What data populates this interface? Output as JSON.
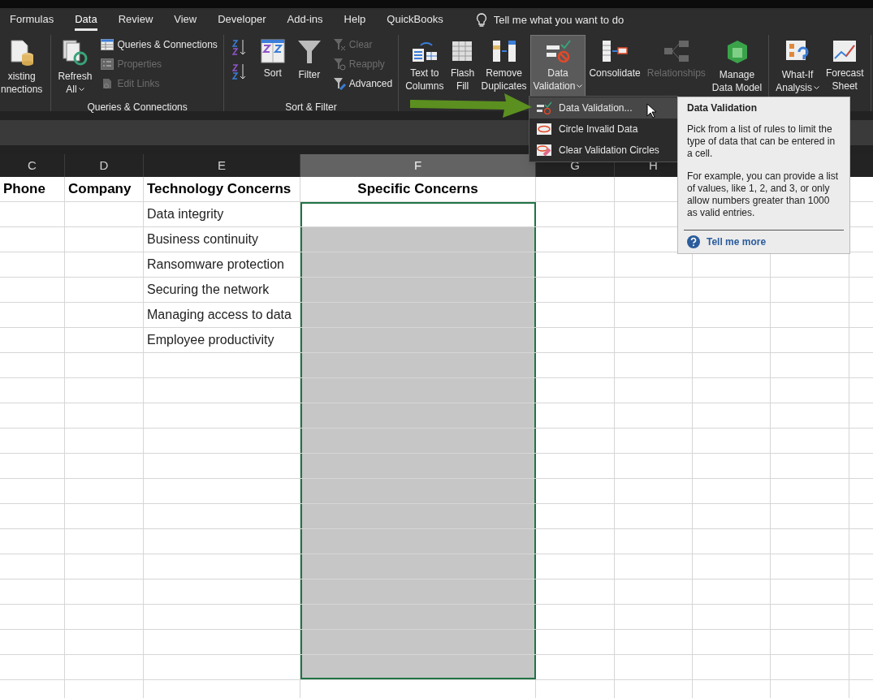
{
  "tabs": [
    {
      "label": "Formulas",
      "selected": false
    },
    {
      "label": "Data",
      "selected": true
    },
    {
      "label": "Review",
      "selected": false
    },
    {
      "label": "View",
      "selected": false
    },
    {
      "label": "Developer",
      "selected": false
    },
    {
      "label": "Add-ins",
      "selected": false
    },
    {
      "label": "Help",
      "selected": false
    },
    {
      "label": "QuickBooks",
      "selected": false
    }
  ],
  "tell_me": {
    "placeholder": "Tell me what you want to do"
  },
  "ribbon_groups": [
    {
      "columns": [
        [
          {
            "kind": "large",
            "lines": [
              "xisting",
              "nnections"
            ],
            "disabled": false,
            "expanded": false,
            "dropdown": false
          }
        ]
      ]
    },
    {
      "label": "Queries & Connections",
      "columns": [
        [
          {
            "kind": "large",
            "lines": [
              "Refresh",
              "All"
            ],
            "disabled": false,
            "expanded": false,
            "dropdown": true
          }
        ],
        [
          {
            "kind": "small",
            "lines": [
              "Queries & Connections"
            ],
            "disabled": false,
            "expanded": false
          },
          {
            "kind": "small",
            "lines": [
              "Properties"
            ],
            "disabled": true,
            "expanded": false
          },
          {
            "kind": "small",
            "lines": [
              "Edit Links"
            ],
            "disabled": true,
            "expanded": false
          }
        ]
      ]
    },
    {
      "label": "Sort & Filter",
      "columns": [
        [
          {
            "kind": "icon",
            "disabled": false,
            "expanded": false
          },
          {
            "kind": "icon",
            "disabled": false,
            "expanded": false
          }
        ],
        [
          {
            "kind": "large",
            "lines": [
              "Sort"
            ],
            "disabled": false,
            "expanded": false,
            "dropdown": false
          }
        ],
        [
          {
            "kind": "large",
            "lines": [
              "Filter"
            ],
            "disabled": false,
            "expanded": false,
            "dropdown": false
          }
        ],
        [
          {
            "kind": "small",
            "lines": [
              "Clear"
            ],
            "disabled": true,
            "expanded": false
          },
          {
            "kind": "small",
            "lines": [
              "Reapply"
            ],
            "disabled": true,
            "expanded": false
          },
          {
            "kind": "small",
            "lines": [
              "Advanced"
            ],
            "disabled": false,
            "expanded": false
          }
        ]
      ]
    },
    {
      "columns": [
        [
          {
            "kind": "large",
            "lines": [
              "Text to",
              "Columns"
            ],
            "disabled": false,
            "expanded": false,
            "dropdown": false
          }
        ],
        [
          {
            "kind": "large",
            "lines": [
              "Flash",
              "Fill"
            ],
            "disabled": false,
            "expanded": false,
            "dropdown": false
          }
        ],
        [
          {
            "kind": "large",
            "lines": [
              "Remove",
              "Duplicates"
            ],
            "disabled": false,
            "expanded": false,
            "dropdown": false
          }
        ],
        [
          {
            "kind": "large",
            "lines": [
              "Data",
              "Validation"
            ],
            "disabled": false,
            "expanded": true,
            "dropdown": true
          }
        ],
        [
          {
            "kind": "large",
            "lines": [
              "Consolidate"
            ],
            "disabled": false,
            "expanded": false,
            "dropdown": false
          }
        ],
        [
          {
            "kind": "large",
            "lines": [
              "Relationships"
            ],
            "disabled": true,
            "expanded": false,
            "dropdown": false
          }
        ],
        [
          {
            "kind": "large",
            "lines": [
              "Manage",
              "Data Model"
            ],
            "disabled": false,
            "expanded": false,
            "dropdown": false
          }
        ]
      ]
    },
    {
      "columns": [
        [
          {
            "kind": "large",
            "lines": [
              "What-If",
              "Analysis"
            ],
            "disabled": false,
            "expanded": false,
            "dropdown": true
          }
        ],
        [
          {
            "kind": "large",
            "lines": [
              "Forecast",
              "Sheet"
            ],
            "disabled": false,
            "expanded": false,
            "dropdown": false
          }
        ]
      ]
    }
  ],
  "dropdown_menu": [
    {
      "label": "Data Validation...",
      "selected": true
    },
    {
      "label": "Circle Invalid Data",
      "selected": false
    },
    {
      "label": "Clear Validation Circles",
      "selected": false
    }
  ],
  "tooltip": {
    "title": "Data Validation",
    "paragraphs": [
      "Pick from a list of rules to limit the type of data that can be entered in a cell.",
      "For example, you can provide a list of values, like 1, 2, and 3, or only allow numbers greater than 1000 as valid entries."
    ],
    "link": "Tell me more"
  },
  "sheet": {
    "columns": [
      {
        "letter": "C",
        "selected": false
      },
      {
        "letter": "D",
        "selected": false
      },
      {
        "letter": "E",
        "selected": false
      },
      {
        "letter": "F",
        "selected": true
      },
      {
        "letter": "G",
        "selected": false
      },
      {
        "letter": "H",
        "selected": false
      }
    ],
    "header_row": [
      "Phone",
      "Company",
      "Technology Concerns",
      "Specific Concerns"
    ],
    "rows": [
      {
        "concern": "Data integrity",
        "selected": false
      },
      {
        "concern": "Business continuity",
        "selected": true
      },
      {
        "concern": "Ransomware protection",
        "selected": true
      },
      {
        "concern": "Securing the network",
        "selected": true
      },
      {
        "concern": "Managing access to data",
        "selected": true
      },
      {
        "concern": "Employee productivity",
        "selected": true
      },
      {
        "selected": true
      },
      {
        "selected": true
      },
      {
        "selected": true
      },
      {
        "selected": true
      },
      {
        "selected": true
      },
      {
        "selected": true
      },
      {
        "selected": true
      },
      {
        "selected": true
      },
      {
        "selected": true
      },
      {
        "selected": true
      },
      {
        "selected": true
      },
      {
        "selected": true
      },
      {
        "selected": true
      },
      {
        "selected": false
      }
    ]
  }
}
